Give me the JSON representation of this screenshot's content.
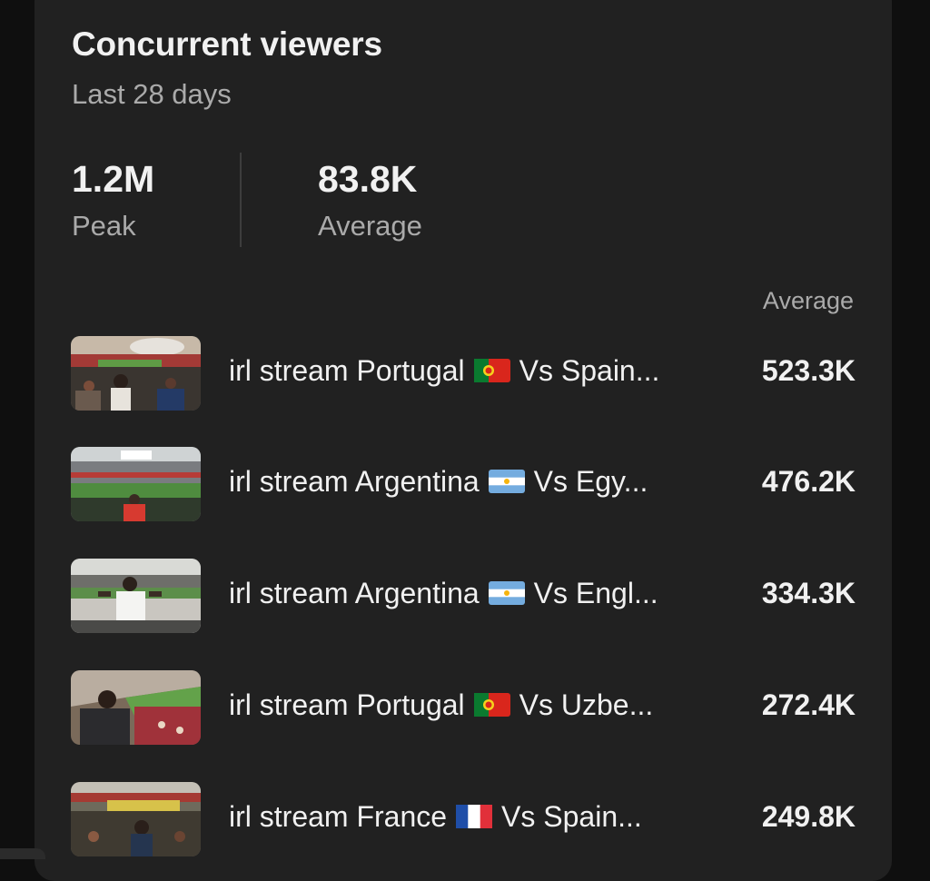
{
  "card": {
    "title": "Concurrent viewers",
    "subtitle": "Last 28 days"
  },
  "stats": {
    "peak": {
      "value": "1.2M",
      "label": "Peak"
    },
    "average": {
      "value": "83.8K",
      "label": "Average"
    }
  },
  "list": {
    "column_header": "Average",
    "items": [
      {
        "title_start": "irl stream Portugal",
        "flag": "portugal-flag",
        "title_end": "Vs Spain...",
        "value": "523.3K"
      },
      {
        "title_start": "irl stream Argentina",
        "flag": "argentina-flag",
        "title_end": "Vs Egy...",
        "value": "476.2K"
      },
      {
        "title_start": "irl stream Argentina",
        "flag": "argentina-flag",
        "title_end": "Vs Engl...",
        "value": "334.3K"
      },
      {
        "title_start": "irl stream Portugal",
        "flag": "portugal-flag",
        "title_end": "Vs Uzbe...",
        "value": "272.4K"
      },
      {
        "title_start": "irl stream France",
        "flag": "france-flag",
        "title_end": "Vs Spain...",
        "value": "249.8K"
      }
    ]
  },
  "colors": {
    "background": "#0f0f0f",
    "card": "#212121",
    "text_primary": "#f1f1f1",
    "text_secondary": "#aaaaaa"
  }
}
